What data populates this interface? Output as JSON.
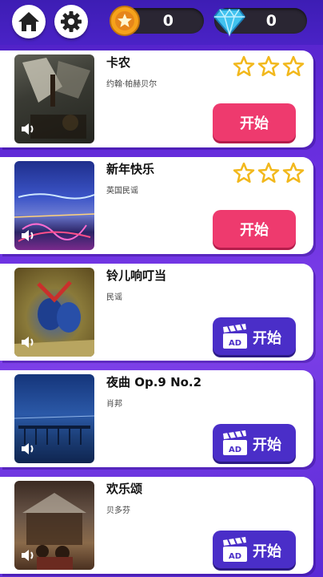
{
  "header": {
    "coins": "0",
    "gems": "0"
  },
  "colors": {
    "background": "#6a2fe0",
    "start_button": "#ee3a6e",
    "ad_button": "#4a2ec8",
    "star_outline": "#f2b81c"
  },
  "songs": [
    {
      "title": "卡农",
      "artist": "约翰·帕赫贝尔",
      "stars_earned": 0,
      "stars_total": 3,
      "action": "开始",
      "requires_ad": false
    },
    {
      "title": "新年快乐",
      "artist": "英国民谣",
      "stars_earned": 0,
      "stars_total": 3,
      "action": "开始",
      "requires_ad": false
    },
    {
      "title": "铃儿响叮当",
      "artist": "民谣",
      "action": "开始",
      "requires_ad": true
    },
    {
      "title": "夜曲 Op.9 No.2",
      "artist": "肖邦",
      "action": "开始",
      "requires_ad": true
    },
    {
      "title": "欢乐颂",
      "artist": "贝多芬",
      "action": "开始",
      "requires_ad": true
    }
  ]
}
